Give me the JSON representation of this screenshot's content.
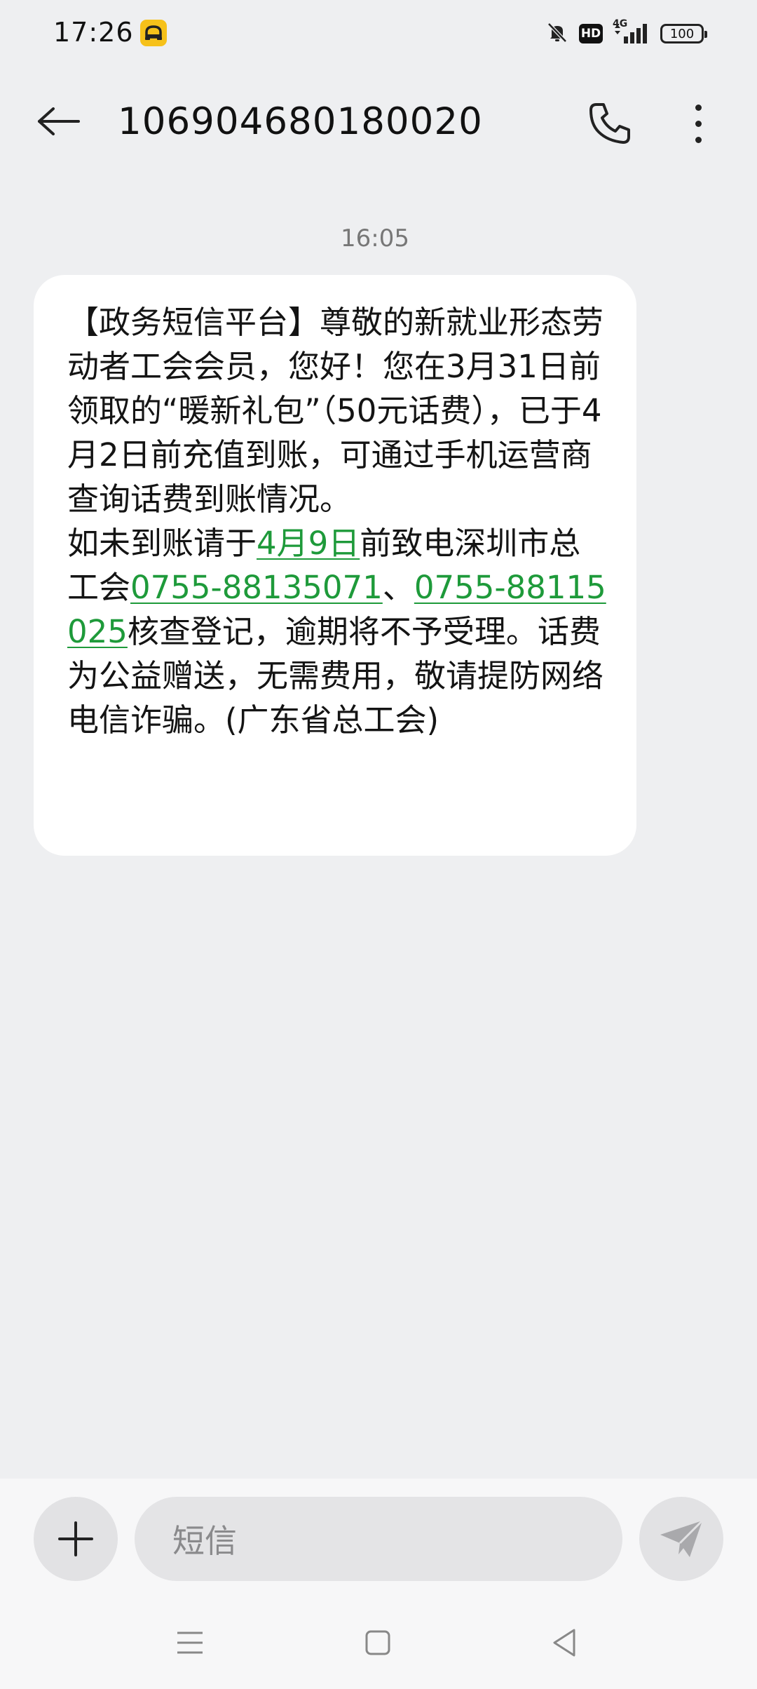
{
  "status_bar": {
    "time": "17:26",
    "battery": "100",
    "hd": "HD",
    "network": "4G",
    "icons": [
      "yellow-app-icon",
      "mute-bell-icon",
      "hd-icon",
      "4g-signal-icon",
      "battery-icon"
    ]
  },
  "header": {
    "title": "106904680180020",
    "back_icon": "arrow-left-icon",
    "call_icon": "phone-icon",
    "more_icon": "more-vertical-icon"
  },
  "conversation": {
    "timestamp": "16:05",
    "message": {
      "part1": "【政务短信平台】尊敬的新就业形态劳动者工会会员，您好！您在3月31日前领取的“暖新礼包”（50元话费），已于4月2日前充值到账，可通过手机运营商查询话费到账情况。",
      "part2_prefix": "如未到账请于",
      "link_date": "4月9日",
      "part2_middle": "前致电深圳市总工会",
      "link_phone1": "0755-88135071",
      "separator": "、",
      "link_phone2": "0755-88115025",
      "part2_suffix": "核查登记，逾期将不予受理。话费为公益赠送，无需费用，敬请提防网络电信诈骗。(广东省总工会)"
    }
  },
  "composer": {
    "placeholder": "短信",
    "add_icon": "plus-icon",
    "send_icon": "send-icon"
  },
  "nav": {
    "icons": [
      "menu-icon",
      "home-square-icon",
      "back-triangle-icon"
    ]
  },
  "colors": {
    "background": "#eeeff1",
    "bubble": "#ffffff",
    "link": "#1e9a3a",
    "input_bg": "#e4e4e6"
  }
}
